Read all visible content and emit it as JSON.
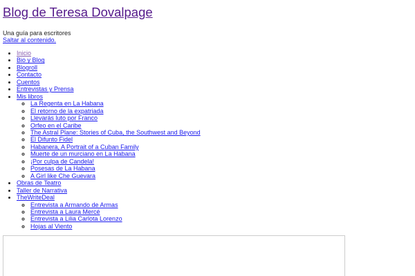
{
  "header": {
    "title": "Blog de Teresa Dovalpage",
    "tagline": "Una guía para escritores",
    "skip_link": "Saltar al contenido."
  },
  "nav": [
    {
      "label": "Inicio",
      "visited": true
    },
    {
      "label": "Bio y Blog"
    },
    {
      "label": "Blogroll"
    },
    {
      "label": "Contacto"
    },
    {
      "label": "Cuentos"
    },
    {
      "label": "Entrevistas y Prensa"
    },
    {
      "label": "Mis libros",
      "children": [
        "La Regenta en La Habana",
        "El retorno de la expatriada",
        "Llevarás luto por Franco",
        "Orfeo en el Caribe",
        "The Astral Plane: Stories of Cuba, the Southwest and Beyond",
        "El Difunto Fidel",
        "Habanera, A Portrait of a Cuban Family",
        "Muerte de un murciano en La Habana",
        "¡Por culpa de Candela!",
        "Posesas de La Habana",
        "A Girl like Che Guevara"
      ]
    },
    {
      "label": "Obras de Teatro"
    },
    {
      "label": "Taller de Narrativa"
    },
    {
      "label": "TheWriteDeal",
      "children": [
        "Entrevista a Armando de Armas",
        "Entrevista a Laura Mercé",
        "Entrevista a Lilia Carlota Lorenzo",
        "Hojas al Viento"
      ]
    }
  ]
}
